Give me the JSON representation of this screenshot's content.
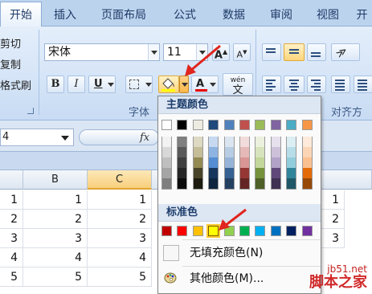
{
  "tabs": [
    {
      "label": "开始",
      "active": true
    },
    {
      "label": "插入",
      "active": false
    },
    {
      "label": "页面布局",
      "active": false
    },
    {
      "label": "公式",
      "active": false
    },
    {
      "label": "数据",
      "active": false
    },
    {
      "label": "审阅",
      "active": false
    },
    {
      "label": "视图",
      "active": false
    },
    {
      "label": "开",
      "active": false
    }
  ],
  "clipboard": {
    "cut": "剪切",
    "copy": "复制",
    "format_painter": "格式刷"
  },
  "font": {
    "name": "宋体",
    "size": "11",
    "grow_label": "A",
    "shrink_label": "A",
    "bold": "B",
    "italic": "I",
    "underline": "U",
    "font_color_label": "A",
    "wen_label": "wén",
    "wen_char": "文",
    "group_label": "字体"
  },
  "alignment": {
    "group_label": "对齐方式"
  },
  "formula_bar": {
    "name_box": "4",
    "fx": "fx"
  },
  "sheet": {
    "columns": [
      "",
      "B",
      "C",
      "",
      ""
    ],
    "rows": [
      {
        "a": "1",
        "b": "1",
        "c": "1",
        "e": "1"
      },
      {
        "a": "2",
        "b": "2",
        "c": "2",
        "e": "2"
      },
      {
        "a": "3",
        "b": "3",
        "c": "3",
        "e": "3"
      },
      {
        "a": "4",
        "b": "4",
        "c": "4",
        "e": ""
      },
      {
        "a": "5",
        "b": "5",
        "c": "5",
        "e": ""
      }
    ]
  },
  "color_menu": {
    "theme_title": "主题颜色",
    "standard_title": "标准色",
    "no_fill_label": "无填充颜色(N)",
    "more_colors_label": "其他颜色(M)...",
    "theme_colors": [
      "#FFFFFF",
      "#000000",
      "#EEECE1",
      "#1F497D",
      "#4F81BD",
      "#C0504D",
      "#9BBB59",
      "#8064A2",
      "#4BACC6",
      "#F79646"
    ],
    "theme_shades": [
      [
        "#F2F2F2",
        "#D8D8D8",
        "#BFBFBF",
        "#A5A5A5",
        "#7F7F7F"
      ],
      [
        "#7F7F7F",
        "#595959",
        "#3F3F3F",
        "#262626",
        "#0C0C0C"
      ],
      [
        "#DDD9C3",
        "#C4BD97",
        "#938953",
        "#494429",
        "#1D1B10"
      ],
      [
        "#C6D9F0",
        "#8DB3E2",
        "#548DD4",
        "#17365D",
        "#0F243E"
      ],
      [
        "#DBE5F1",
        "#B8CCE4",
        "#95B3D7",
        "#366092",
        "#244061"
      ],
      [
        "#F2DCDB",
        "#E5B9B7",
        "#D99694",
        "#953734",
        "#632423"
      ],
      [
        "#EBF1DD",
        "#D7E3BC",
        "#C3D69B",
        "#76923C",
        "#4F6128"
      ],
      [
        "#E5E0EC",
        "#CCC1D9",
        "#B2A2C7",
        "#5F497A",
        "#3F3151"
      ],
      [
        "#DBEEF3",
        "#B7DDE8",
        "#92CDDC",
        "#31859B",
        "#205867"
      ],
      [
        "#FDEADA",
        "#FBD5B5",
        "#FAC08F",
        "#E36C09",
        "#974806"
      ]
    ],
    "standard_colors": [
      "#C00000",
      "#FF0000",
      "#FFC000",
      "#FFFF00",
      "#92D050",
      "#00B050",
      "#00B0F0",
      "#0070C0",
      "#002060",
      "#7030A0"
    ],
    "highlighted_standard_index": 3
  },
  "watermark": {
    "line1": "jb51.net",
    "line2": "脚本之家"
  }
}
